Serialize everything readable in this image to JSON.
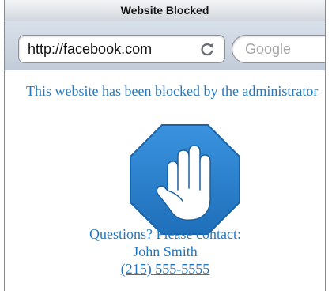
{
  "window": {
    "title": "Website Blocked"
  },
  "toolbar": {
    "url": "http://facebook.com",
    "reload_icon": "reload-icon",
    "search_placeholder": "Google"
  },
  "page": {
    "message": "This website has been blocked by the administrator",
    "icon": "stop-hand-icon",
    "contact_heading": "Questions? Please contact:",
    "contact_name": "John Smith",
    "contact_phone": "(215) 555-5555"
  },
  "colors": {
    "text_accent": "#2477bf",
    "stop_sign": "#2e86d6",
    "stop_sign_dark": "#1b63a8"
  }
}
